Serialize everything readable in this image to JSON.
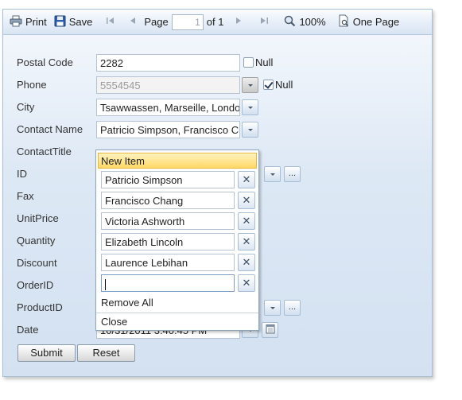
{
  "toolbar": {
    "print_label": "Print",
    "save_label": "Save",
    "page_label": "Page",
    "page_value": "1",
    "page_of": "of 1",
    "zoom": "100%",
    "one_page": "One Page"
  },
  "form": {
    "postal_code": {
      "label": "Postal Code",
      "value": "2282",
      "null_label": "Null"
    },
    "phone": {
      "label": "Phone",
      "value": "5554545",
      "null_label": "Null"
    },
    "city": {
      "label": "City",
      "value": "Tsawwassen, Marseille, Londo"
    },
    "contact_name": {
      "label": "Contact Name",
      "value": "Patricio Simpson, Francisco C"
    },
    "contact_title": {
      "label": "ContactTitle"
    },
    "id": {
      "label": "ID"
    },
    "fax": {
      "label": "Fax"
    },
    "unit_price": {
      "label": "UnitPrice"
    },
    "quantity": {
      "label": "Quantity"
    },
    "discount": {
      "label": "Discount"
    },
    "order_id": {
      "label": "OrderID"
    },
    "product_id": {
      "label": "ProductID"
    },
    "date": {
      "label": "Date",
      "value": "10/31/2011 3:40:45 PM"
    }
  },
  "popup": {
    "new_item": "New Item",
    "items": [
      "Patricio Simpson",
      "Francisco Chang",
      "Victoria Ashworth",
      "Elizabeth Lincoln",
      "Laurence Lebihan",
      ""
    ],
    "remove_all": "Remove All",
    "close": "Close"
  },
  "buttons": {
    "submit": "Submit",
    "reset": "Reset"
  }
}
